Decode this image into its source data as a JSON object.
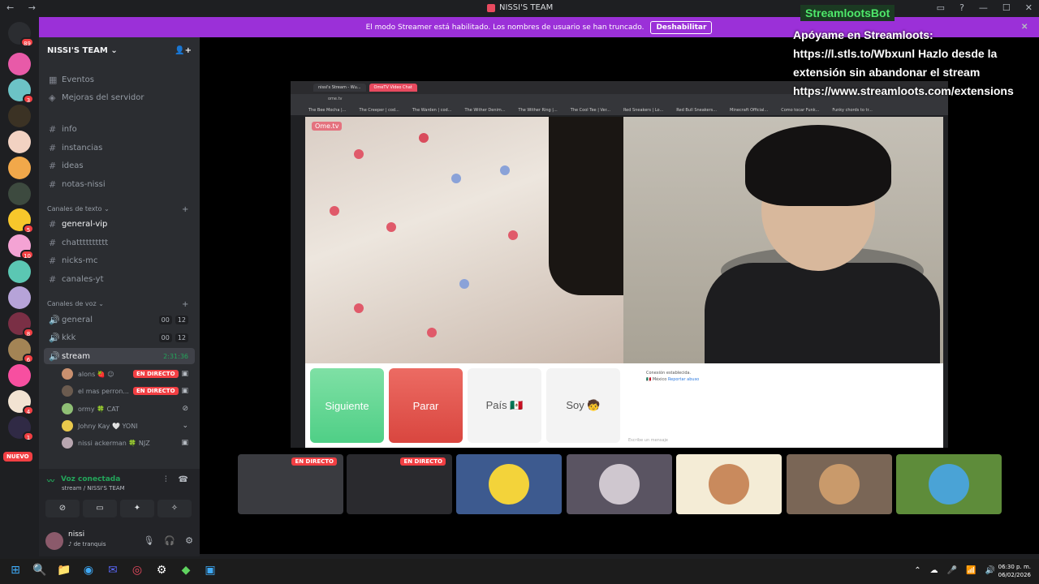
{
  "window": {
    "title": "NISSI'S TEAM",
    "nav": [
      "←",
      "→"
    ],
    "controls": [
      "▭",
      "?",
      "—",
      "☐",
      "✕"
    ]
  },
  "banner": {
    "text": "El modo Streamer está habilitado. Los nombres de usuario se han truncado.",
    "button": "Deshabilitar"
  },
  "rail": {
    "badges": [
      "89",
      "3",
      "5",
      "10",
      "8",
      "6",
      "4",
      "1"
    ],
    "new_label": "NUEVO"
  },
  "guild": {
    "name": "NISSI'S TEAM ⌄",
    "invite_icon": "👤+"
  },
  "channels": {
    "top": [
      {
        "icon": "▦",
        "label": "Eventos"
      },
      {
        "icon": "◈",
        "label": "Mejoras del servidor"
      }
    ],
    "text_free": [
      {
        "icon": "#",
        "label": "info"
      },
      {
        "icon": "#",
        "label": "instancias"
      },
      {
        "icon": "#",
        "label": "ideas"
      },
      {
        "icon": "#",
        "label": "notas-nissi"
      }
    ],
    "text_category": "Canales de texto ⌄",
    "text": [
      {
        "icon": "#",
        "label": "general-vip"
      },
      {
        "icon": "#",
        "label": "chatttttttttt"
      },
      {
        "icon": "#",
        "label": "nicks-mc"
      },
      {
        "icon": "#",
        "label": "canales-yt"
      }
    ],
    "voice_category": "Canales de voz ⌄",
    "voice": [
      {
        "icon": "🔊",
        "label": "general",
        "a": "00",
        "b": "12"
      },
      {
        "icon": "🔊",
        "label": "kkk",
        "a": "00",
        "b": "12"
      },
      {
        "icon": "🔊",
        "label": "stream",
        "time": "2:31:36"
      }
    ],
    "plus": "+"
  },
  "voice_users": [
    {
      "name": "alons 🍓 ☺",
      "live": "EN DIRECTO",
      "icon": "▣",
      "color": "#c9906f"
    },
    {
      "name": "el mas perron...",
      "live": "EN DIRECTO",
      "icon": "▣",
      "color": "#6b5b4f"
    },
    {
      "name": "ormy 🍀 CAT",
      "live": "",
      "icon": "⊘",
      "color": "#8fbf75"
    },
    {
      "name": "Johny Kay 🤍 YONI",
      "live": "",
      "icon": "⌄",
      "color": "#e9c94c"
    },
    {
      "name": "nissi ackerman 🍀 NJZ",
      "live": "",
      "icon": "▣",
      "color": "#b8a6b0"
    }
  ],
  "voice_panel": {
    "status": "Voz conectada",
    "sub": "stream / NISSI'S TEAM",
    "icons": [
      "⫶",
      "☎"
    ],
    "buttons": [
      "⊘",
      "▭",
      "✦",
      "✧"
    ]
  },
  "user": {
    "name": "nissi",
    "status": "♪ de tranquis",
    "controls": [
      "🎙",
      "🎧",
      "⚙"
    ]
  },
  "browser": {
    "tabs": [
      "nissi's Stream - Wu...",
      "OmeTV Video Chat"
    ],
    "url": "ome.tv",
    "bookmarks": [
      "The Bee Mocha |...",
      "The Creeper | cod...",
      "The Warden | cod...",
      "The Wither Denim...",
      "The Wither Ring |...",
      "The Cool Tee | Ver...",
      "Red Sneakers | Lo...",
      "Red Bull Sneakers...",
      "Minecraft Official...",
      "Como tocar Funk...",
      "Funky chords to tr..."
    ],
    "logo": "Ome.tv"
  },
  "ometv": {
    "next": "Siguiente",
    "stop": "Parar",
    "country": "País 🇲🇽",
    "soy": "Soy 🧒",
    "chat_line1": "Conexión establecida.",
    "chat_country": "🇲🇽 México",
    "chat_report": "Reportar abuso",
    "chat_input": "Escribe un mensaje"
  },
  "overlay": {
    "bot": "StreamlootsBot",
    "text": "Apóyame en Streamloots: https://l.stls.to/Wbxunl Hazlo desde la extensión sin abandonar el stream https://www.streamloots.com/extensions",
    "close": "✕"
  },
  "tiles": [
    {
      "live": "EN DIRECTO",
      "bg": "#3a3b40"
    },
    {
      "live": "EN DIRECTO",
      "bg": "#2a2a2e"
    },
    {
      "live": "",
      "bg": "#3d5a8f",
      "av": "#f3d33a"
    },
    {
      "live": "",
      "bg": "#5a5462",
      "av": "#cfc7cf"
    },
    {
      "live": "",
      "bg": "#f4ecd6",
      "av": "#c98a5d"
    },
    {
      "live": "",
      "bg": "#7a6656",
      "av": "#c99a6b"
    },
    {
      "live": "",
      "bg": "#5e8c3a",
      "av": "#4aa3d6"
    }
  ],
  "taskbar": {
    "icons": [
      "⊞",
      "🔍",
      "📁",
      "◉",
      "✉",
      "◎",
      "⚙",
      "◆",
      "▣"
    ],
    "tray": [
      "⌃",
      "☁",
      "🎤",
      "📶",
      "🔊"
    ],
    "time": "06:30 p. m.",
    "date": "06/02/2026"
  }
}
